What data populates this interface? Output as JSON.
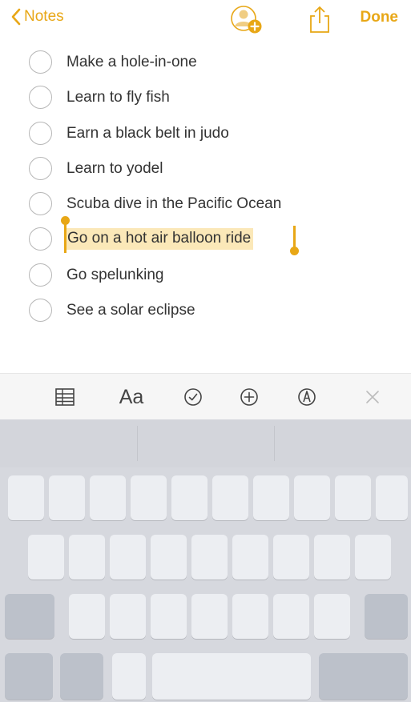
{
  "nav": {
    "back_label": "Notes",
    "done_label": "Done",
    "collaborate_icon": "add-person-icon",
    "share_icon": "share-icon",
    "accent_color": "#e8a716"
  },
  "checklist": {
    "items": [
      {
        "label": "Make a hole-in-one",
        "checked": false
      },
      {
        "label": "Learn to fly fish",
        "checked": false
      },
      {
        "label": "Earn a black belt in judo",
        "checked": false
      },
      {
        "label": "Learn to yodel",
        "checked": false
      },
      {
        "label": "Scuba dive in the Pacific Ocean",
        "checked": false
      },
      {
        "label": "Go on a hot air balloon ride",
        "checked": false,
        "selected": true
      },
      {
        "label": "Go spelunking",
        "checked": false
      },
      {
        "label": "See a solar eclipse",
        "checked": false
      }
    ],
    "selection_color": "#fbe8b8"
  },
  "toolbar": {
    "items": [
      "table-icon",
      "Aa",
      "checklist-icon",
      "add-icon",
      "markup-icon",
      "close-icon"
    ],
    "format_label": "Aa"
  },
  "keyboard": {
    "suggestions": [
      "",
      "",
      ""
    ]
  }
}
